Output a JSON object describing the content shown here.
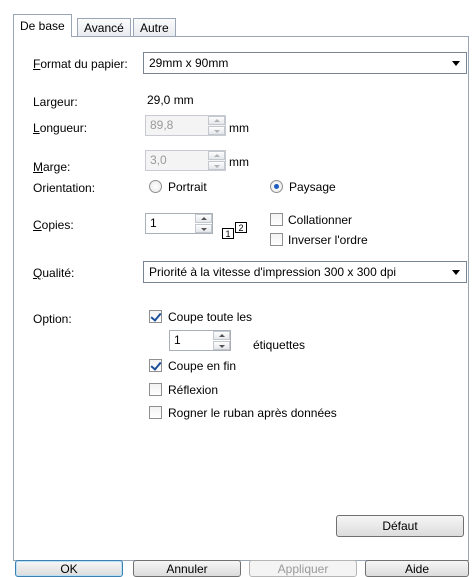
{
  "tabs": [
    {
      "label": "De base",
      "active": true
    },
    {
      "label": "Avancé",
      "active": false
    },
    {
      "label": "Autre",
      "active": false
    }
  ],
  "paper": {
    "format_label_u": "F",
    "format_label_rest": "ormat du papier:",
    "format_value": "29mm x 90mm",
    "width_label": "Largeur:",
    "width_value": "29,0 mm",
    "length_label_u": "L",
    "length_label_rest": "ongueur:",
    "length_value": "89,8",
    "length_unit": "mm",
    "margin_label_u": "M",
    "margin_label_rest": "arge:",
    "margin_value": "3,0",
    "margin_unit": "mm",
    "orientation_label": "Orientation:",
    "portrait_label": "Portrait",
    "landscape_label": "Paysage",
    "selected_orientation": "Paysage"
  },
  "copies": {
    "label_u": "C",
    "label_rest": "opies:",
    "value": "1",
    "icon_digits": [
      "1",
      "2"
    ],
    "collate_label": "Collationner",
    "collate_checked": false,
    "reverse_label": "Inverser l'ordre",
    "reverse_checked": false
  },
  "quality": {
    "label_u": "Q",
    "label_rest": "ualité:",
    "value": "Priorité à la vitesse d'impression 300 x 300 dpi"
  },
  "option": {
    "label": "Option:",
    "cut_every_label": "Coupe toute les",
    "cut_every_checked": true,
    "cut_every_value": "1",
    "labels_unit": "étiquettes",
    "cut_end_label": "Coupe en fin",
    "cut_end_checked": true,
    "mirror_label": "Réflexion",
    "mirror_checked": false,
    "trim_label": "Rogner le ruban après données",
    "trim_checked": false
  },
  "default_button": "Défaut",
  "footer": {
    "ok": "OK",
    "cancel": "Annuler",
    "apply": "Appliquer",
    "help": "Aide"
  },
  "colors": {
    "accent": "#1e5bbf",
    "panel_border": "#9aa6b4",
    "disabled_text": "#9a9a9a"
  }
}
